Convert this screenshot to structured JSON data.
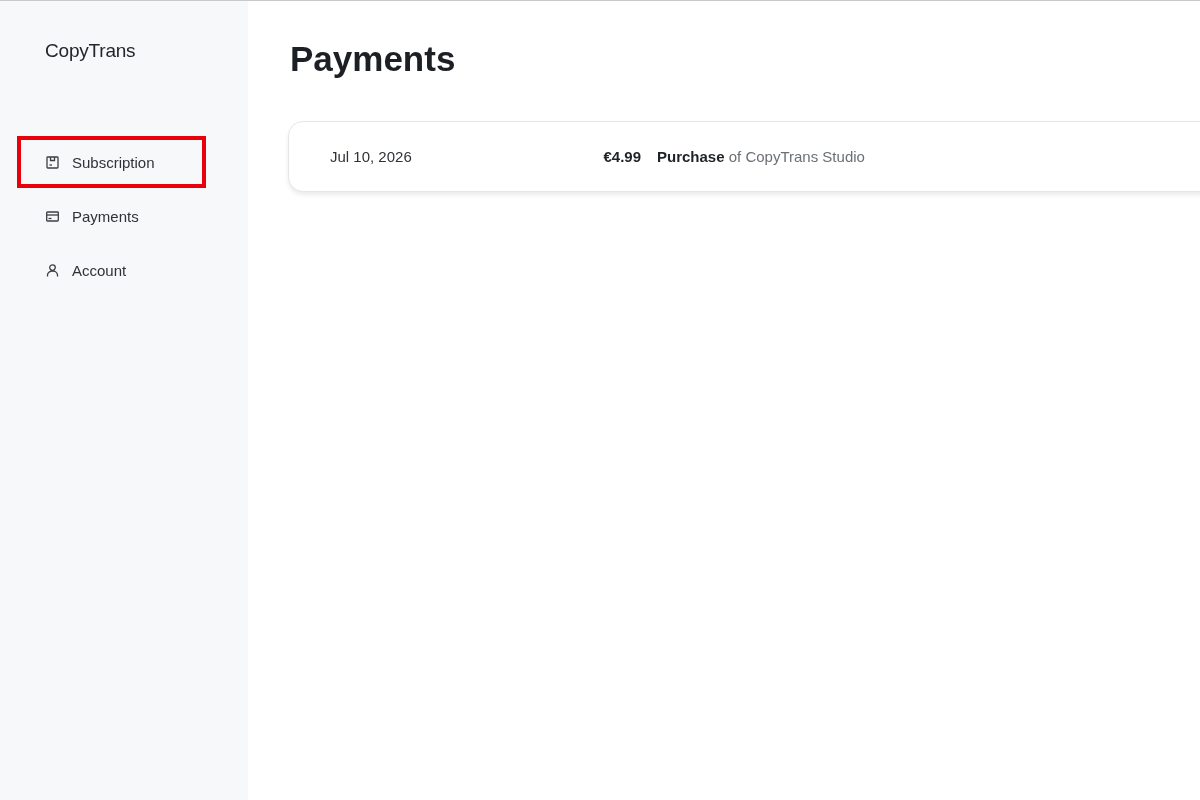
{
  "sidebar": {
    "logo": "CopyTrans",
    "items": [
      {
        "label": "Subscription",
        "kind": "subscription",
        "highlighted": true
      },
      {
        "label": "Payments",
        "kind": "card",
        "highlighted": false
      },
      {
        "label": "Account",
        "kind": "user",
        "highlighted": false
      }
    ]
  },
  "page": {
    "title": "Payments"
  },
  "payments": [
    {
      "date": "Jul 10, 2026",
      "amount": "€4.99",
      "description": "**Purchase** of CopyTrans Studio"
    }
  ]
}
